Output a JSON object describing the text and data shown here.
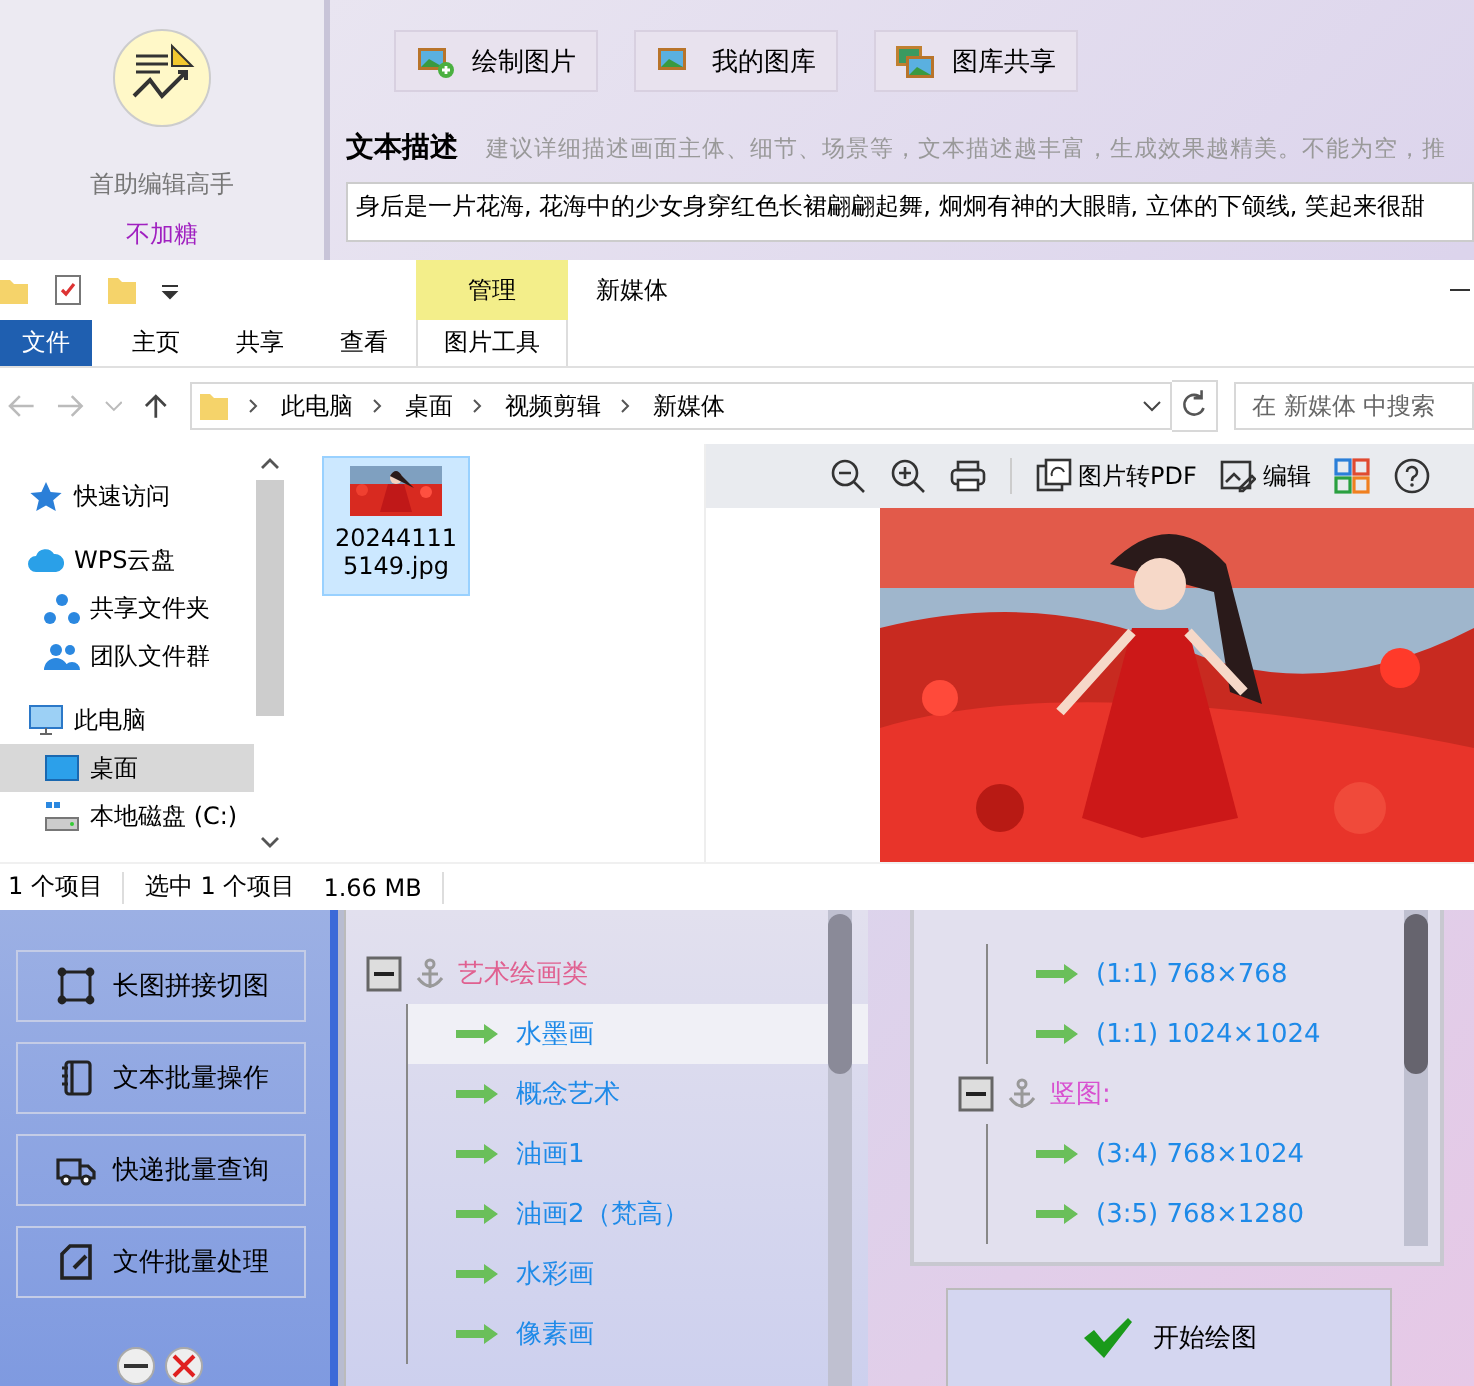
{
  "app": {
    "name": "首助编辑高手",
    "user": "不加糖",
    "toolbar": [
      {
        "label": "绘制图片",
        "kind": "draw"
      },
      {
        "label": "我的图库",
        "kind": "gallery"
      },
      {
        "label": "图库共享",
        "kind": "share"
      }
    ],
    "prompt": {
      "label": "文本描述",
      "hint": "建议详细描述画面主体、细节、场景等，文本描述越丰富，生成效果越精美。不能为空，推",
      "value": "身后是一片花海, 花海中的少女身穿红色长裙翩翩起舞, 炯炯有神的大眼睛, 立体的下颌线, 笑起来很甜"
    },
    "side_buttons": [
      {
        "label": "长图拼接切图",
        "kind": "stitch"
      },
      {
        "label": "文本批量操作",
        "kind": "text"
      },
      {
        "label": "快递批量查询",
        "kind": "truck"
      },
      {
        "label": "文件批量处理",
        "kind": "file"
      }
    ],
    "style_tree": [
      {
        "label": "艺术绘画类",
        "expanded": true,
        "children": [
          {
            "label": "水墨画",
            "selected": true
          },
          {
            "label": "概念艺术",
            "selected": false
          },
          {
            "label": "油画1",
            "selected": false
          },
          {
            "label": "油画2（梵高）",
            "selected": false
          },
          {
            "label": "水彩画",
            "selected": false
          },
          {
            "label": "像素画",
            "selected": false
          }
        ]
      }
    ],
    "size_tree": [
      {
        "kind": "leaf",
        "label": "(1:1) 768×768"
      },
      {
        "kind": "leaf",
        "label": "(1:1) 1024×1024"
      },
      {
        "kind": "group",
        "label": "竖图:",
        "expanded": true,
        "children": [
          {
            "label": "(3:4) 768×1024"
          },
          {
            "label": "(3:5) 768×1280"
          }
        ]
      }
    ],
    "start_button": "开始绘图"
  },
  "explorer": {
    "title": "新媒体",
    "context_tab": "管理",
    "tabs": [
      {
        "label": "文件",
        "selected": true
      },
      {
        "label": "主页",
        "selected": false
      },
      {
        "label": "共享",
        "selected": false
      },
      {
        "label": "查看",
        "selected": false
      },
      {
        "label": "图片工具",
        "selected": false
      }
    ],
    "path": [
      "此电脑",
      "桌面",
      "视频剪辑",
      "新媒体"
    ],
    "search": {
      "placeholder": "在 新媒体 中搜索"
    },
    "nav": [
      {
        "label": "快速访问",
        "kind": "star",
        "selected": false
      },
      {
        "label": "WPS云盘",
        "kind": "cloud",
        "selected": false
      },
      {
        "label": "共享文件夹",
        "kind": "share",
        "selected": false,
        "indent": true
      },
      {
        "label": "团队文件群",
        "kind": "team",
        "selected": false,
        "indent": true
      },
      {
        "label": "此电脑",
        "kind": "pc",
        "selected": false
      },
      {
        "label": "桌面",
        "kind": "desktop",
        "selected": true,
        "indent": true
      },
      {
        "label": "本地磁盘 (C:)",
        "kind": "disk",
        "selected": false,
        "indent": true
      }
    ],
    "file": {
      "name": "202441115149.jpg",
      "selected": true
    },
    "preview_tools": [
      {
        "kind": "zoom-out"
      },
      {
        "kind": "zoom-in"
      },
      {
        "kind": "print"
      },
      {
        "kind": "pdf",
        "label": "图片转PDF"
      },
      {
        "kind": "edit",
        "label": "编辑"
      },
      {
        "kind": "apps"
      },
      {
        "kind": "help"
      }
    ],
    "status": {
      "count": "1 个项目",
      "selection": "选中 1 个项目",
      "size": "1.66 MB"
    }
  }
}
